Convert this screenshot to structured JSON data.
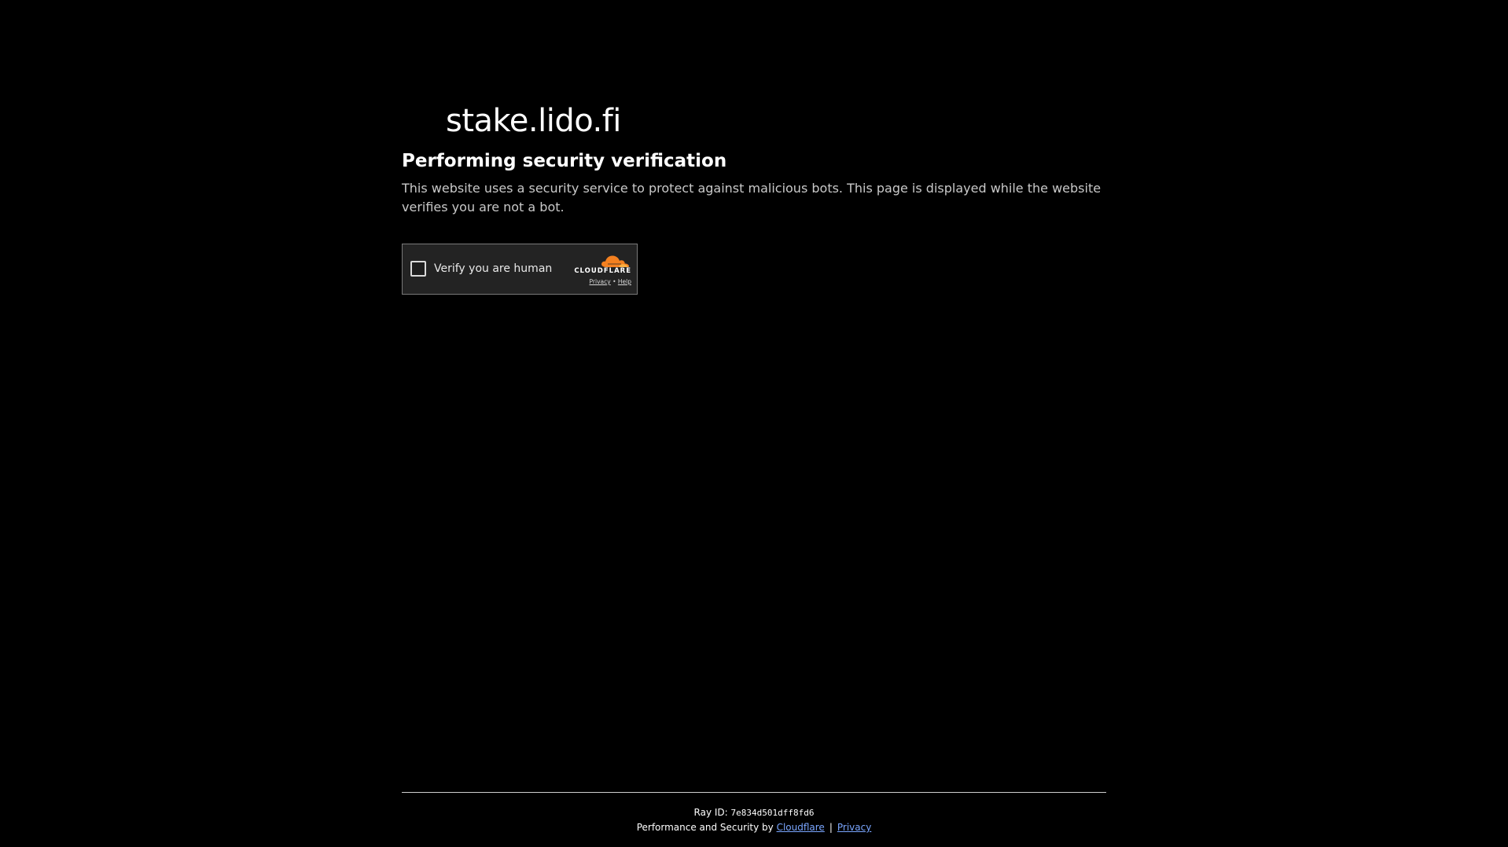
{
  "site": {
    "domain": "stake.lido.fi"
  },
  "main": {
    "heading": "Performing security verification",
    "description": "This website uses a security service to protect against malicious bots. This page is displayed while the website verifies you are not a bot."
  },
  "widget": {
    "checkbox_label": "Verify you are human",
    "brand_name": "CLOUDFLARE",
    "privacy_link": "Privacy",
    "link_separator": "•",
    "help_link": "Help",
    "brand_color": "#f38020"
  },
  "footer": {
    "ray_label": "Ray ID: ",
    "ray_id": "7e834d501dff8fd6",
    "performance_text": "Performance and Security by ",
    "cloudflare_link": "Cloudflare",
    "separator": "|",
    "privacy_link": "Privacy"
  }
}
